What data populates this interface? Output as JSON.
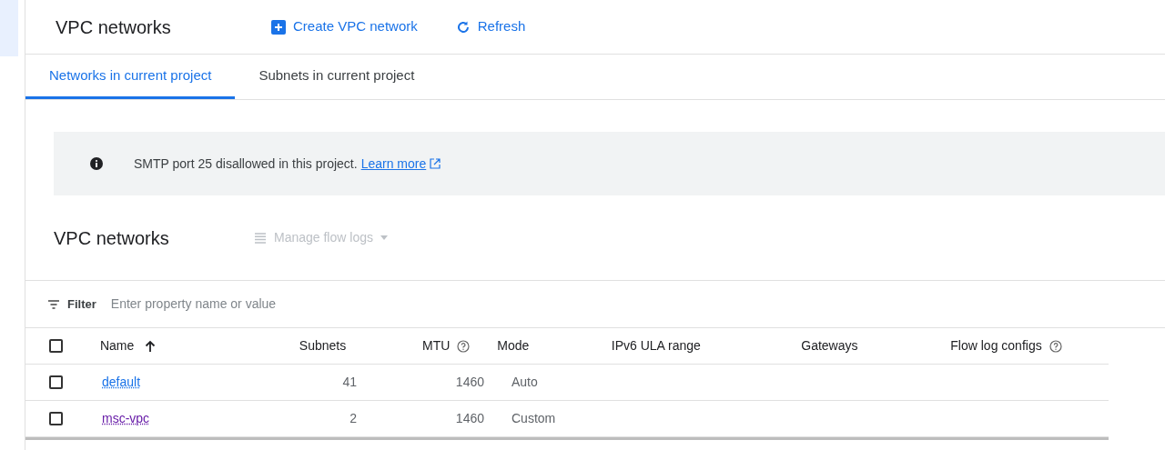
{
  "header": {
    "title": "VPC networks",
    "actions": [
      {
        "kind": "create",
        "label": "Create VPC network"
      },
      {
        "kind": "refresh",
        "label": "Refresh"
      }
    ]
  },
  "tabs": [
    {
      "label": "Networks in current project",
      "selected": true
    },
    {
      "label": "Subnets in current project",
      "selected": false
    }
  ],
  "banner": {
    "text": "SMTP port 25 disallowed in this project.",
    "link": "Learn more"
  },
  "section": {
    "title": "VPC networks",
    "menu": "Manage flow logs"
  },
  "filter": {
    "label": "Filter",
    "placeholder": "Enter property name or value"
  },
  "table": {
    "select_all": {
      "checked": false
    },
    "columns": [
      {
        "label": "Name",
        "kind": "sorted"
      },
      {
        "label": "Subnets",
        "kind": "plain"
      },
      {
        "label": "MTU",
        "kind": "help"
      },
      {
        "label": "Mode",
        "kind": "plain"
      },
      {
        "label": "IPv6 ULA range",
        "kind": "plain"
      },
      {
        "label": "Gateways",
        "kind": "plain"
      },
      {
        "label": "Flow log configs",
        "kind": "help"
      }
    ],
    "rows": [
      {
        "checked": false,
        "name": "default",
        "visited": false,
        "subnets": "41",
        "mtu": "1460",
        "mode": "Auto"
      },
      {
        "checked": false,
        "name": "msc-vpc",
        "visited": true,
        "subnets": "2",
        "mtu": "1460",
        "mode": "Custom"
      }
    ]
  }
}
